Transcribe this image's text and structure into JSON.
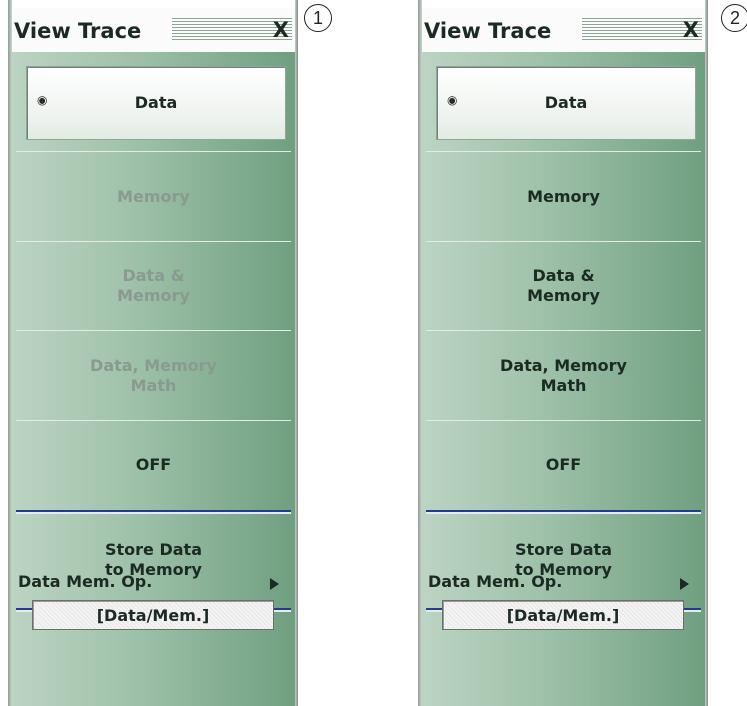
{
  "callouts": [
    "1",
    "2"
  ],
  "panels": [
    {
      "title": "View Trace",
      "close_label": "X",
      "selected": {
        "label": "Data",
        "radio": "◉"
      },
      "buttons": {
        "memory": "Memory",
        "data_memory": "Data &\nMemory",
        "data_memory_math": "Data, Memory\nMath",
        "off": "OFF",
        "store": "Store Data\nto Memory"
      },
      "memory_options_enabled": false,
      "data_mem_op": {
        "label": "Data Mem. Op.",
        "value": "[Data/Mem.]"
      }
    },
    {
      "title": "View Trace",
      "close_label": "X",
      "selected": {
        "label": "Data",
        "radio": "◉"
      },
      "buttons": {
        "memory": "Memory",
        "data_memory": "Data &\nMemory",
        "data_memory_math": "Data, Memory\nMath",
        "off": "OFF",
        "store": "Store Data\nto Memory"
      },
      "memory_options_enabled": true,
      "data_mem_op": {
        "label": "Data Mem. Op.",
        "value": "[Data/Mem.]"
      }
    }
  ]
}
